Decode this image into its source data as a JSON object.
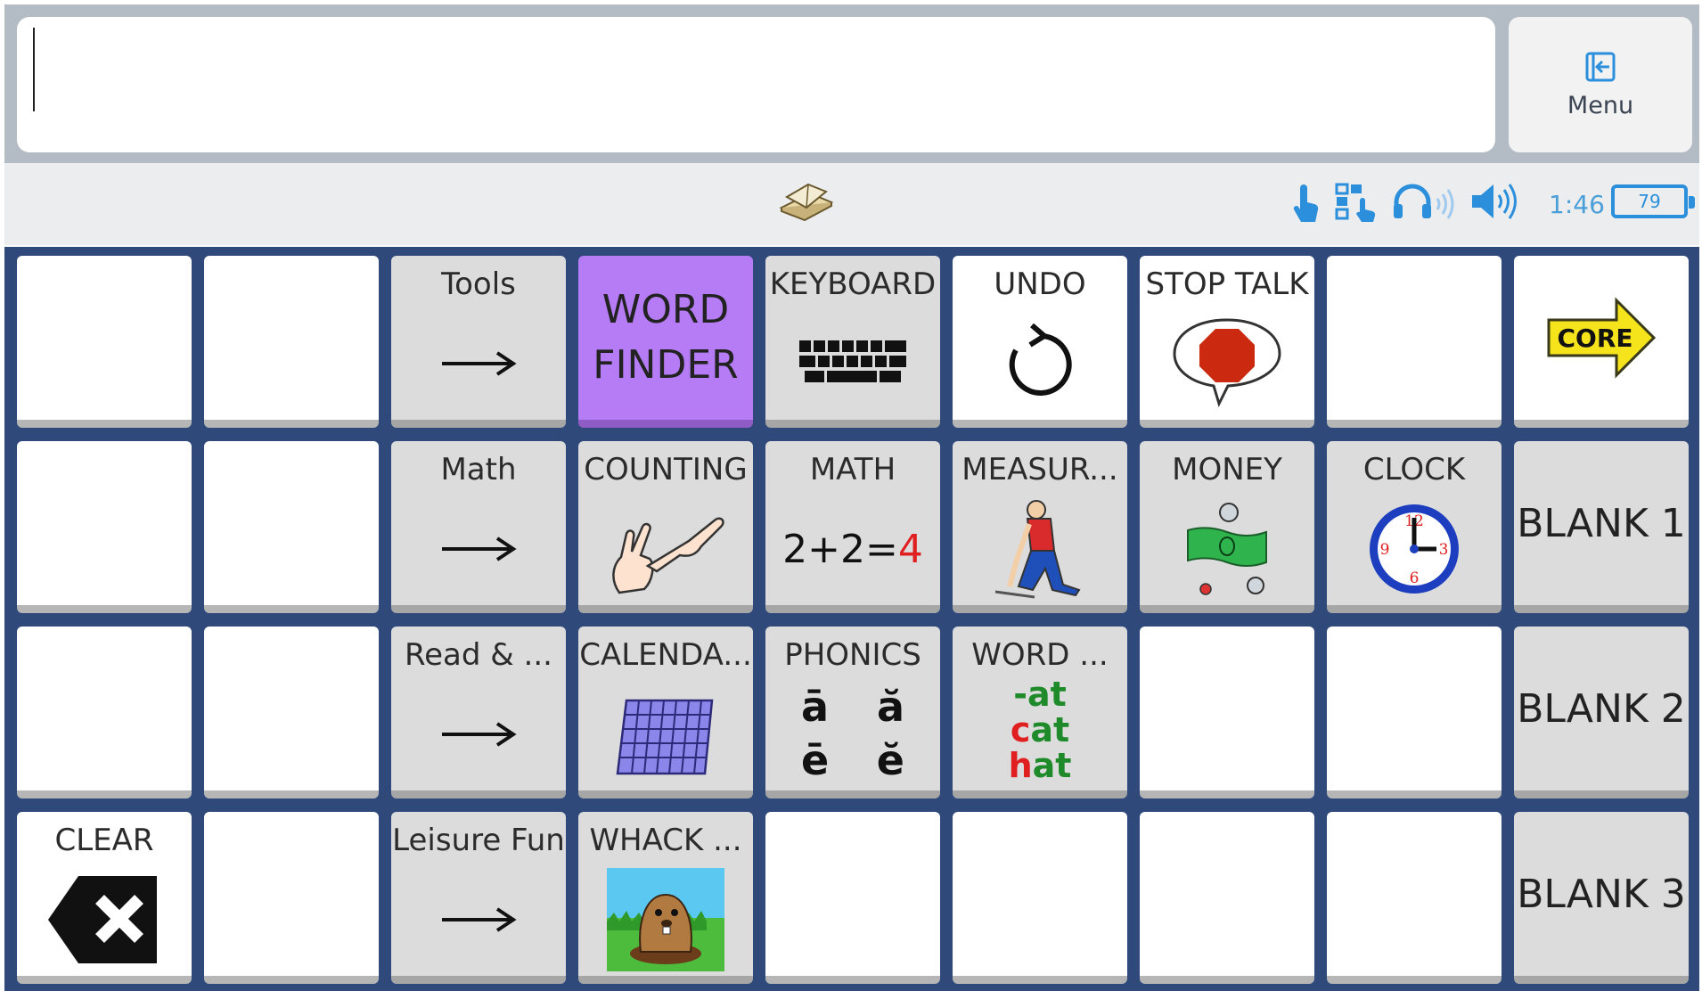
{
  "message": {
    "text": ""
  },
  "menu": {
    "label": "Menu"
  },
  "status": {
    "time": "1:46",
    "battery": "79"
  },
  "grid": {
    "r1": {
      "tools": "Tools",
      "word_finder": "WORD FINDER",
      "keyboard": "KEYBOARD",
      "undo": "UNDO",
      "stop_talk": "STOP TALK",
      "core": "CORE"
    },
    "r2": {
      "math": "Math",
      "counting": "COUNTING",
      "math_btn": "MATH",
      "math_eq_a": "2+2=",
      "math_eq_b": "4",
      "measure": "MEASUR...",
      "money": "MONEY",
      "clock": "CLOCK",
      "blank1": "BLANK 1"
    },
    "r3": {
      "read": "Read & ...",
      "calendar": "CALENDA...",
      "phonics": "PHONICS",
      "phonics_glyphs": [
        "ā",
        "ă",
        "ē",
        "ĕ"
      ],
      "word_fam": "WORD ...",
      "word_fam_lines": [
        "-at",
        "cat",
        "hat"
      ],
      "blank2": "BLANK 2"
    },
    "r4": {
      "clear": "CLEAR",
      "leisure": "Leisure Fun",
      "whack": "WHACK ...",
      "blank3": "BLANK 3"
    }
  },
  "colors": {
    "grid_bg": "#2f4a7a",
    "word_finder": "#b57cf5",
    "accent": "#2b8fdc"
  }
}
